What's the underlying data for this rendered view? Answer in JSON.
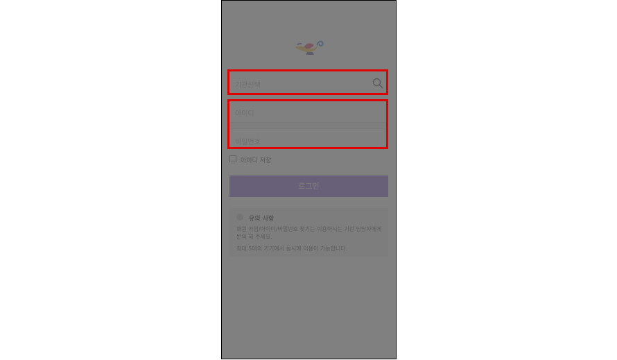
{
  "login": {
    "institution_placeholder": "기관선택",
    "id_placeholder": "아이디",
    "password_placeholder": "비밀번호",
    "save_id_label": "아이디 저장",
    "login_button": "로그인"
  },
  "notice": {
    "title": "유의 사항",
    "line1": "회원 가입/아이디/비밀번호 찾기는 이용하시는 기관 담당자에게 문의 해 주세요.",
    "line2": "최대 5대의 기기에서 동시에 이용이 가능합니다."
  },
  "colors": {
    "accent": "#7a4fd4",
    "highlight": "#e00000",
    "overlay": "#646464"
  },
  "icons": [
    "lamp-logo-icon",
    "search-icon",
    "checkbox-icon",
    "info-icon"
  ]
}
